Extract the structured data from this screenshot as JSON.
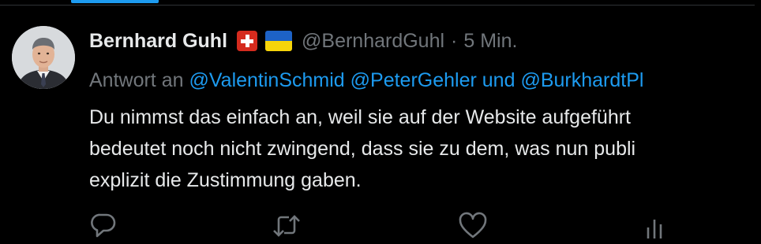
{
  "theme": {
    "background": "#000000",
    "text_primary": "#e7e9ea",
    "text_secondary": "#71767b",
    "accent": "#1d9bf0"
  },
  "tweet": {
    "author_name": "Bernhard Guhl",
    "badges": [
      "swiss-flag-icon",
      "ukraine-flag-icon"
    ],
    "handle": "@BernhardGuhl",
    "separator": "·",
    "time": "5 Min.",
    "reply_prefix": "Antwort an",
    "reply_mentions": [
      "@ValentinSchmid",
      "@PeterGehler"
    ],
    "reply_joiner": "und",
    "reply_last_mention": "@BurkhardtPl",
    "body_lines": [
      "Du nimmst das einfach an, weil sie auf der Website aufgeführt",
      "bedeutet noch nicht zwingend, dass sie zu dem, was nun publi",
      "explizit die Zustimmung gaben."
    ],
    "actions": [
      "reply-icon",
      "retweet-icon",
      "like-icon",
      "views-icon"
    ]
  }
}
